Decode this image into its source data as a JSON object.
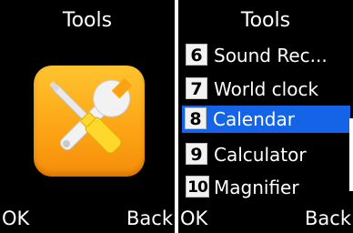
{
  "left_screen": {
    "title": "Tools",
    "icon": "wrench-screwdriver-icon",
    "softkeys": {
      "left": "OK",
      "right": "Back"
    }
  },
  "right_screen": {
    "title": "Tools",
    "menu": [
      {
        "num": "6",
        "label": "Sound Rec..."
      },
      {
        "num": "7",
        "label": "World clock"
      },
      {
        "num": "8",
        "label": "Calendar",
        "selected": true
      },
      {
        "num": "9",
        "label": "Calculator"
      },
      {
        "num": "10",
        "label": "Magnifier"
      }
    ],
    "softkeys": {
      "left": "OK",
      "right": "Back"
    }
  },
  "colors": {
    "background": "#000000",
    "highlight": "#1563e6",
    "icon_orange": "#fca314",
    "text": "#ffffff"
  }
}
